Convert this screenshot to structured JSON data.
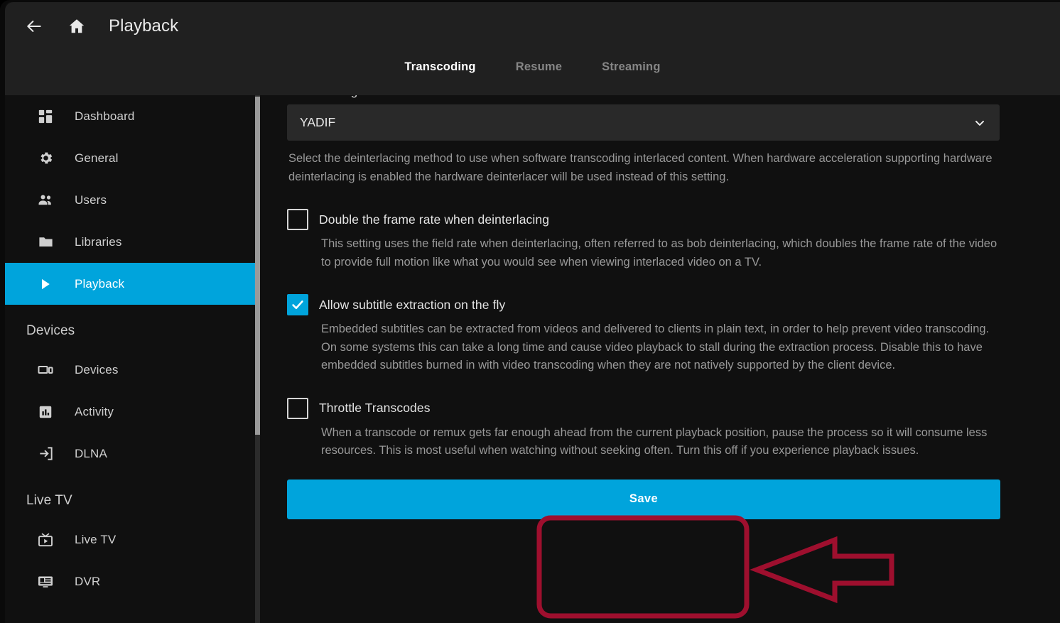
{
  "header": {
    "back_icon": "arrow-left-icon",
    "home_icon": "home-icon",
    "title": "Playback",
    "tabs": [
      {
        "label": "Transcoding",
        "active": true
      },
      {
        "label": "Resume",
        "active": false
      },
      {
        "label": "Streaming",
        "active": false
      }
    ]
  },
  "sidebar": {
    "items": [
      {
        "label": "Dashboard",
        "icon": "dashboard-icon",
        "active": false
      },
      {
        "label": "General",
        "icon": "gear-icon",
        "active": false
      },
      {
        "label": "Users",
        "icon": "users-icon",
        "active": false
      },
      {
        "label": "Libraries",
        "icon": "folder-icon",
        "active": false
      },
      {
        "label": "Playback",
        "icon": "play-icon",
        "active": true
      }
    ],
    "devices_heading": "Devices",
    "devices_items": [
      {
        "label": "Devices",
        "icon": "device-icon"
      },
      {
        "label": "Activity",
        "icon": "chart-bar-icon"
      },
      {
        "label": "DLNA",
        "icon": "login-arrow-icon"
      }
    ],
    "livetv_heading": "Live TV",
    "livetv_items": [
      {
        "label": "Live TV",
        "icon": "tv-icon"
      },
      {
        "label": "DVR",
        "icon": "dvr-icon"
      }
    ]
  },
  "main": {
    "deinterlace_label": "Deinterlacing method:",
    "deinterlace_value": "YADIF",
    "deinterlace_chevron": "chevron-down-icon",
    "deinterlace_desc": "Select the deinterlacing method to use when software transcoding interlaced content. When hardware acceleration supporting hardware deinterlacing is enabled the hardware deinterlacer will be used instead of this setting.",
    "settings": [
      {
        "label": "Double the frame rate when deinterlacing",
        "checked": false,
        "desc": "This setting uses the field rate when deinterlacing, often referred to as bob deinterlacing, which doubles the frame rate of the video to provide full motion like what you would see when viewing interlaced video on a TV."
      },
      {
        "label": "Allow subtitle extraction on the fly",
        "checked": true,
        "desc": "Embedded subtitles can be extracted from videos and delivered to clients in plain text, in order to help prevent video transcoding. On some systems this can take a long time and cause video playback to stall during the extraction process. Disable this to have embedded subtitles burned in with video transcoding when they are not natively supported by the client device."
      },
      {
        "label": "Throttle Transcodes",
        "checked": false,
        "desc": "When a transcode or remux gets far enough ahead from the current playback position, pause the process so it will consume less resources. This is most useful when watching without seeking often. Turn this off if you experience playback issues."
      }
    ],
    "save_label": "Save"
  },
  "annotation": {
    "highlight_shape": "rounded-rectangle-highlight",
    "pointer_shape": "left-arrow-pointer",
    "color": "#9e0f2e"
  },
  "colors": {
    "accent": "#00a4dc",
    "header_bg": "#202020",
    "body_bg": "#101010",
    "select_bg": "#292929",
    "annotation_red": "#9e0f2e"
  }
}
